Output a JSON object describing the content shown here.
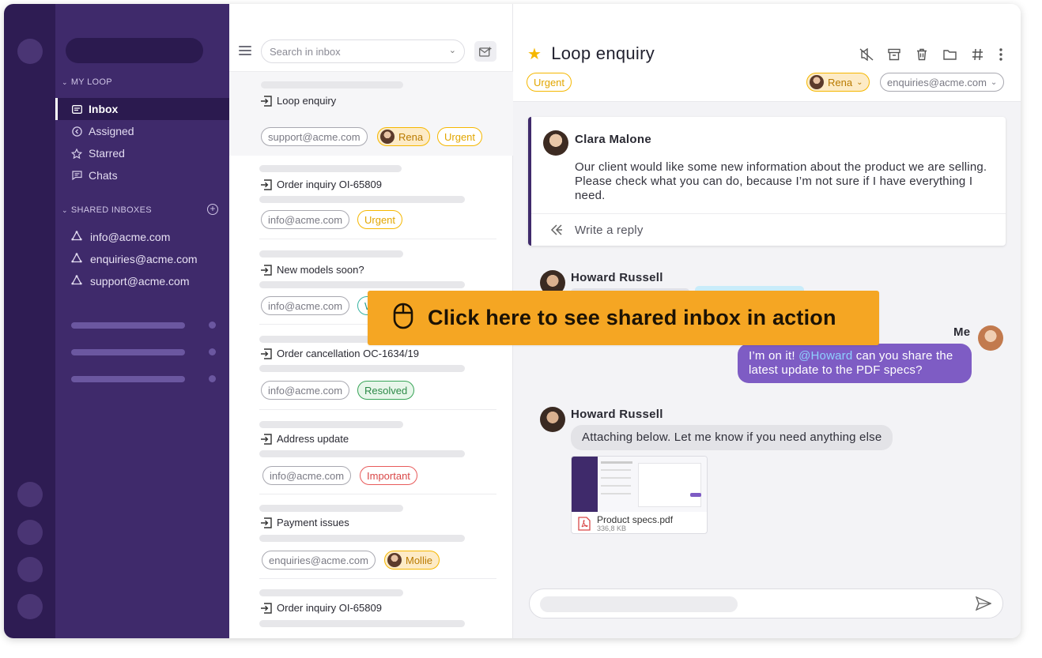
{
  "sidebar": {
    "my_loop_label": "MY LOOP",
    "nav": [
      {
        "label": "Inbox",
        "icon": "inbox-icon"
      },
      {
        "label": "Assigned",
        "icon": "assigned-icon"
      },
      {
        "label": "Starred",
        "icon": "star-icon"
      },
      {
        "label": "Chats",
        "icon": "chat-icon"
      }
    ],
    "shared_label": "SHARED INBOXES",
    "shared_add": "+",
    "inboxes": [
      "info@acme.com",
      "enquiries@acme.com",
      "support@acme.com"
    ]
  },
  "list": {
    "search_placeholder": "Search in inbox",
    "conversations": [
      {
        "subject": "Loop enquiry",
        "chips": [
          "support@acme.com",
          "Rena",
          "Urgent"
        ]
      },
      {
        "subject": "Order inquiry OI-65809",
        "chips": [
          "info@acme.com",
          "Urgent"
        ]
      },
      {
        "subject": "New models soon?",
        "chips": [
          "info@acme.com",
          "W"
        ]
      },
      {
        "subject": "Order cancellation OC-1634/19",
        "chips": [
          "info@acme.com",
          "Resolved"
        ]
      },
      {
        "subject": "Address update",
        "chips": [
          "info@acme.com",
          "Important"
        ]
      },
      {
        "subject": "Payment issues",
        "chips": [
          "enquiries@acme.com",
          "Mollie"
        ]
      },
      {
        "subject": "Order inquiry OI-65809",
        "chips": []
      }
    ]
  },
  "detail": {
    "title": "Loop enquiry",
    "tag": "Urgent",
    "assignee": "Rena",
    "inbox": "enquiries@acme.com",
    "first_message": {
      "author": "Clara Malone",
      "text": "Our client would like some new information about the product we are selling. Please check what you can do, because I’m not sure if I have everything I need.",
      "reply_placeholder": "Write a reply"
    },
    "second_author": "Howard Russell",
    "me_label": "Me",
    "my_message_prefix": "I’m on it! ",
    "my_message_mention": "@Howard",
    "my_message_suffix": " can you share the latest update to the PDF specs?",
    "third_author": "Howard Russell",
    "third_message": "Attaching below. Let me know if you need anything else",
    "attachment_name": "Product specs.pdf",
    "attachment_size": "336,8 KB"
  },
  "cta": {
    "text": "Click here to see shared inbox in action"
  },
  "colors": {
    "rail": "#2e1c53",
    "sidebar": "#3f2a6b",
    "accent": "#7e5cc4",
    "cta": "#f5a623",
    "urgent": "#f5b700"
  }
}
